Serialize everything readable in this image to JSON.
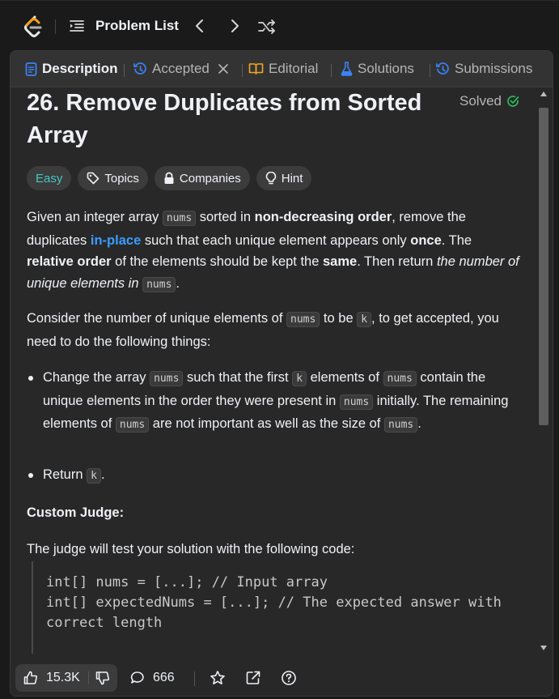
{
  "topbar": {
    "problem_list_label": "Problem List"
  },
  "tabs": [
    {
      "label": "Description",
      "icon": "description-icon"
    },
    {
      "label": "Accepted",
      "icon": "history-icon"
    },
    {
      "label": "Editorial",
      "icon": "book-icon"
    },
    {
      "label": "Solutions",
      "icon": "flask-icon"
    },
    {
      "label": "Submissions",
      "icon": "history-icon"
    }
  ],
  "problem": {
    "title": "26. Remove Duplicates from Sorted Array",
    "status": "Solved",
    "difficulty": "Easy",
    "chips": {
      "topics": "Topics",
      "companies": "Companies",
      "hint": "Hint"
    }
  },
  "description": {
    "p1": {
      "t1": "Given an integer array ",
      "c1": "nums",
      "t2": " sorted in ",
      "b1": "non-decreasing order",
      "t3": ", remove the duplicates ",
      "l1": "in-place",
      "t4": " such that each unique element appears only ",
      "b2": "once",
      "t5": ". The ",
      "b3": "relative order",
      "t6": " of the elements should be kept the ",
      "b4": "same",
      "t7": ". Then return ",
      "i1": "the number of unique elements in",
      "t8": " ",
      "c2": "nums",
      "t9": "."
    },
    "p2": {
      "t1": "Consider the number of unique elements of ",
      "c1": "nums",
      "t2": " to be ",
      "c2": "k",
      "t3": ", to get accepted, you need to do the following things:"
    },
    "bullet1": {
      "t1": "Change the array ",
      "c1": "nums",
      "t2": " such that the first ",
      "c2": "k",
      "t3": " elements of ",
      "c3": "nums",
      "t4": " contain the unique elements in the order they were present in ",
      "c4": "nums",
      "t5": " initially. The remaining elements of ",
      "c5": "nums",
      "t6": " are not important as well as the size of ",
      "c6": "nums",
      "t7": "."
    },
    "bullet2": {
      "t1": "Return ",
      "c1": "k",
      "t2": "."
    },
    "custom_judge_heading": "Custom Judge:",
    "judge_text": "The judge will test your solution with the following code:",
    "code_lines": [
      "int[] nums = [...]; // Input array",
      "int[] expectedNums = [...]; // The expected answer with",
      "correct length"
    ]
  },
  "bottombar": {
    "likes": "15.3K",
    "comments": "666"
  },
  "colors": {
    "easy": "#46c6c2",
    "solved_check": "#2cbb5d",
    "link": "#3b9cff",
    "description_icon": "#3b82f6",
    "flask_icon": "#3b82f6",
    "accepted_icon": "#3b82f6",
    "editorial_icon": "#f5a623"
  }
}
